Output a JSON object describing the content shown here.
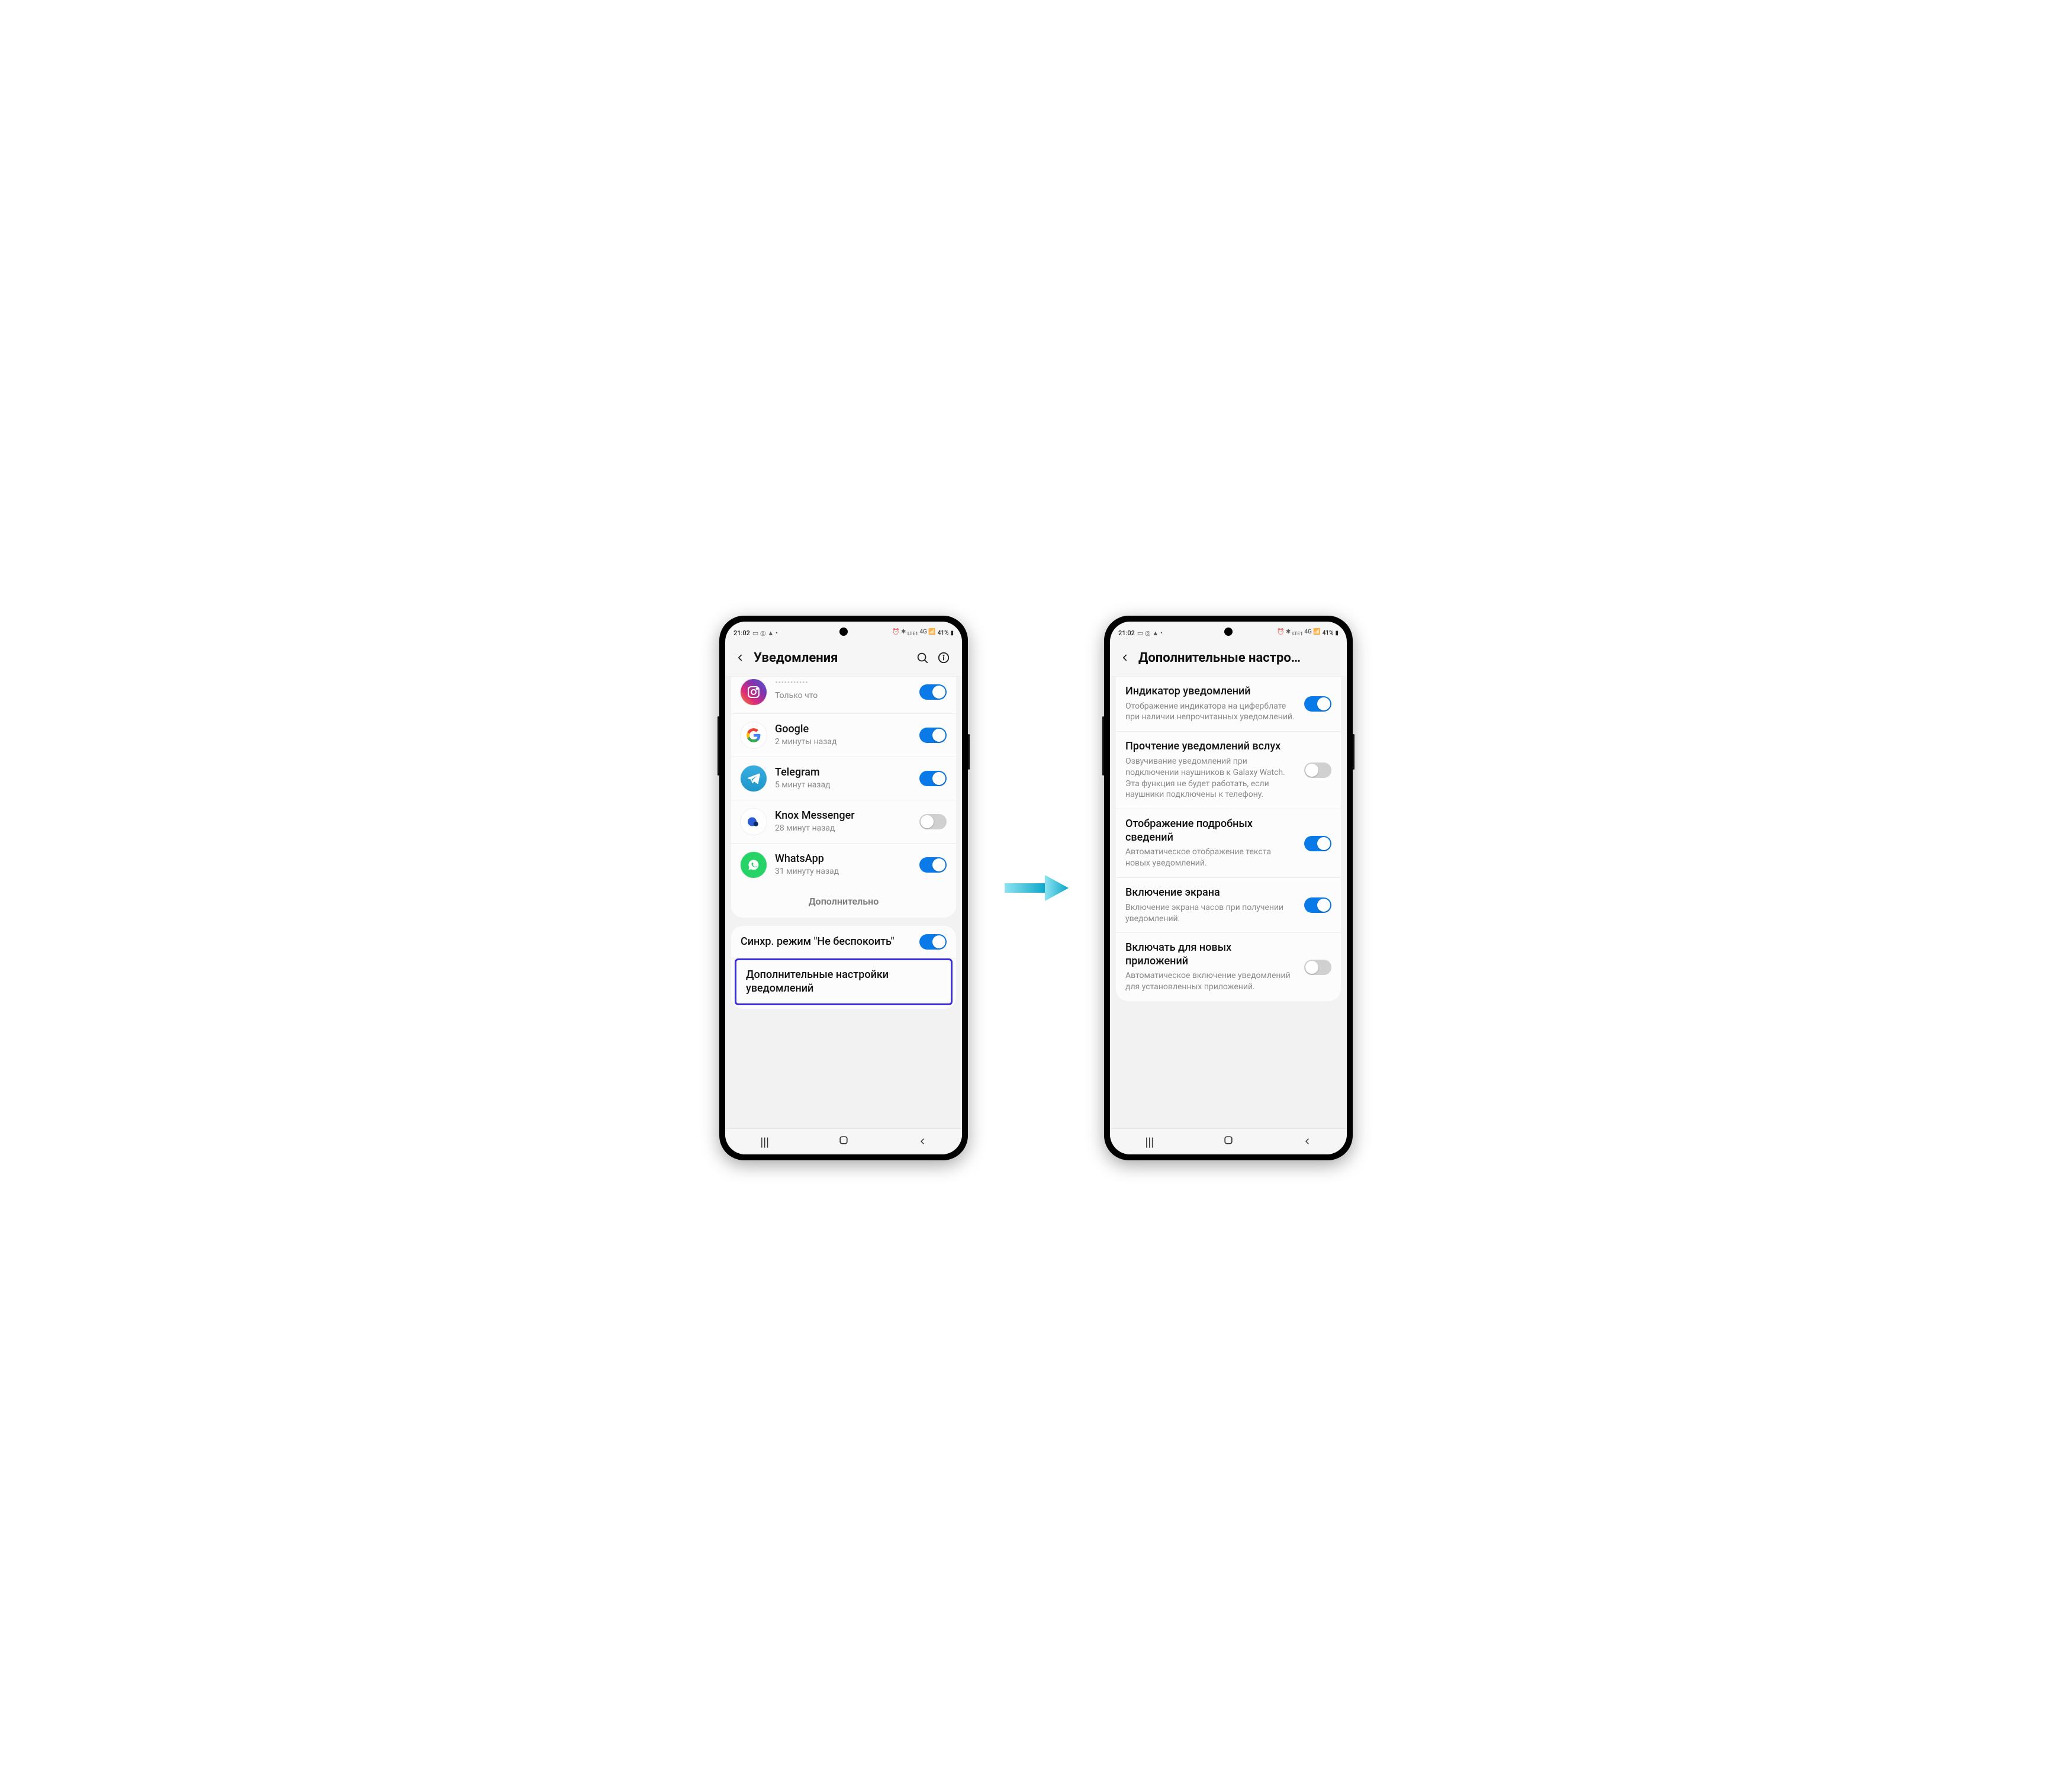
{
  "status": {
    "time": "21:02",
    "battery": "41%",
    "right_icons": "⏰ ✱ VoB 4G ⁄₄ ⏸"
  },
  "left": {
    "title": "Уведомления",
    "apps": [
      {
        "name": "Instagram",
        "sub": "Только что",
        "toggle": "on",
        "icon": "instagram"
      },
      {
        "name": "Google",
        "sub": "2 минуты назад",
        "toggle": "on",
        "icon": "google"
      },
      {
        "name": "Telegram",
        "sub": "5 минут назад",
        "toggle": "on",
        "icon": "telegram"
      },
      {
        "name": "Knox Messenger",
        "sub": "28 минут назад",
        "toggle": "off",
        "icon": "knox"
      },
      {
        "name": "WhatsApp",
        "sub": "31 минуту назад",
        "toggle": "on",
        "icon": "whatsapp"
      }
    ],
    "more_label": "Дополнительно",
    "sync_dnd": {
      "title": "Синхр. режим \"Не беспокоить\"",
      "toggle": "on"
    },
    "advanced_label": "Дополнительные настройки уведомлений"
  },
  "right": {
    "title": "Дополнительные настро…",
    "settings": [
      {
        "title": "Индикатор уведомлений",
        "desc": "Отображение индикатора на циферблате при наличии непрочитанных уведомлений.",
        "toggle": "on"
      },
      {
        "title": "Прочтение уведомлений вслух",
        "desc": "Озвучивание уведомлений при подключении наушников к Galaxy Watch. Эта функция не будет работать, если наушники подключены к телефону.",
        "toggle": "off"
      },
      {
        "title": "Отображение подробных сведений",
        "desc": "Автоматическое отображение текста новых уведомлений.",
        "toggle": "on"
      },
      {
        "title": "Включение экрана",
        "desc": "Включение экрана часов при получении уведомлений.",
        "toggle": "on"
      },
      {
        "title": "Включать для новых приложений",
        "desc": "Автоматическое включение уведомлений для установленных приложений.",
        "toggle": "off"
      }
    ]
  },
  "colors": {
    "accent": "#0a7ae8",
    "highlight": "#3b2edc",
    "arrow": "#1fb6d9"
  }
}
